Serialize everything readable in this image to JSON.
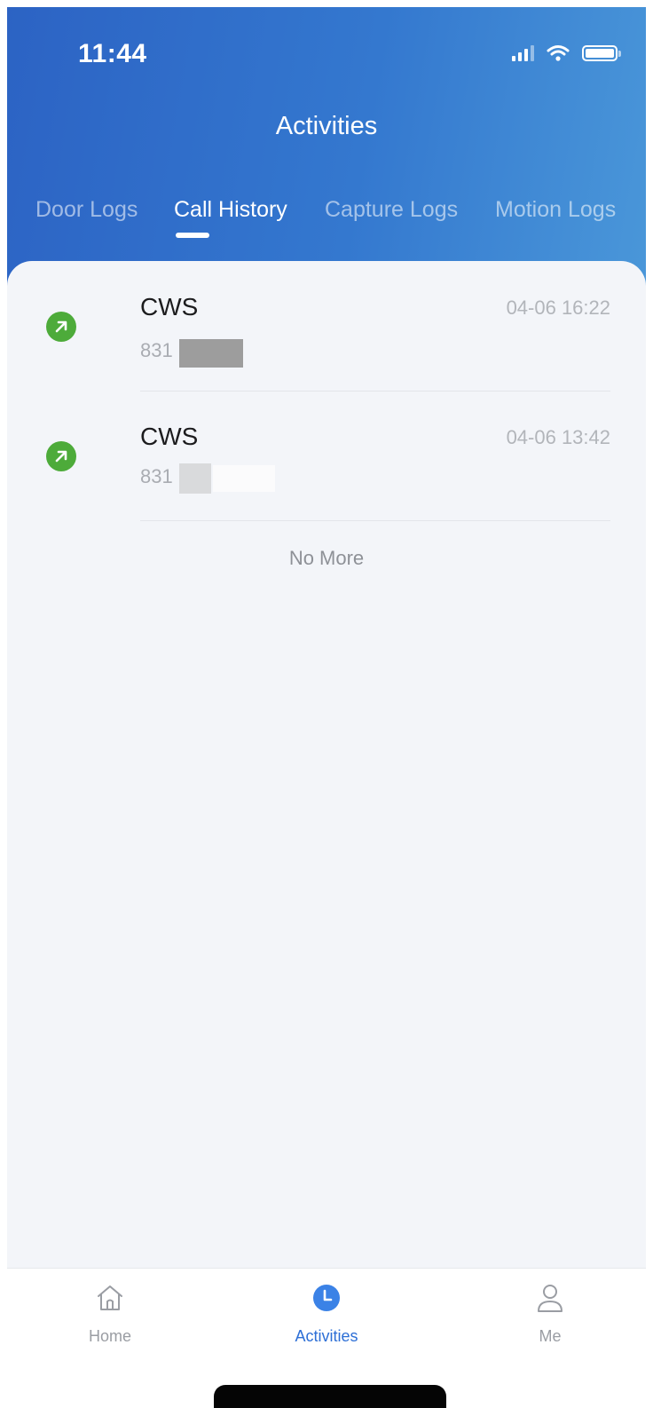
{
  "status_bar": {
    "time": "11:44",
    "icons": [
      "signal-icon",
      "wifi-icon",
      "battery-icon"
    ]
  },
  "header": {
    "title": "Activities",
    "tabs": [
      {
        "label": "Door Logs",
        "active": false
      },
      {
        "label": "Call History",
        "active": true
      },
      {
        "label": "Capture Logs",
        "active": false
      },
      {
        "label": "Motion Logs",
        "active": false
      }
    ]
  },
  "calls": [
    {
      "name": "CWS",
      "number": "831",
      "time": "04-06  16:22",
      "icon": "outgoing-call-icon"
    },
    {
      "name": "CWS",
      "number": "831",
      "time": "04-06  13:42",
      "icon": "outgoing-call-icon"
    }
  ],
  "list_footer": "No More",
  "tabbar": {
    "items": [
      {
        "label": "Home",
        "icon": "home-icon",
        "active": false
      },
      {
        "label": "Activities",
        "icon": "clock-icon",
        "active": true
      },
      {
        "label": "Me",
        "icon": "person-icon",
        "active": false
      }
    ]
  },
  "colors": {
    "header_start": "#2c63c4",
    "header_end": "#4a97d9",
    "call_icon": "#4dab3a",
    "active_tab": "#2d6fd6",
    "content_bg": "#f3f5f9"
  }
}
